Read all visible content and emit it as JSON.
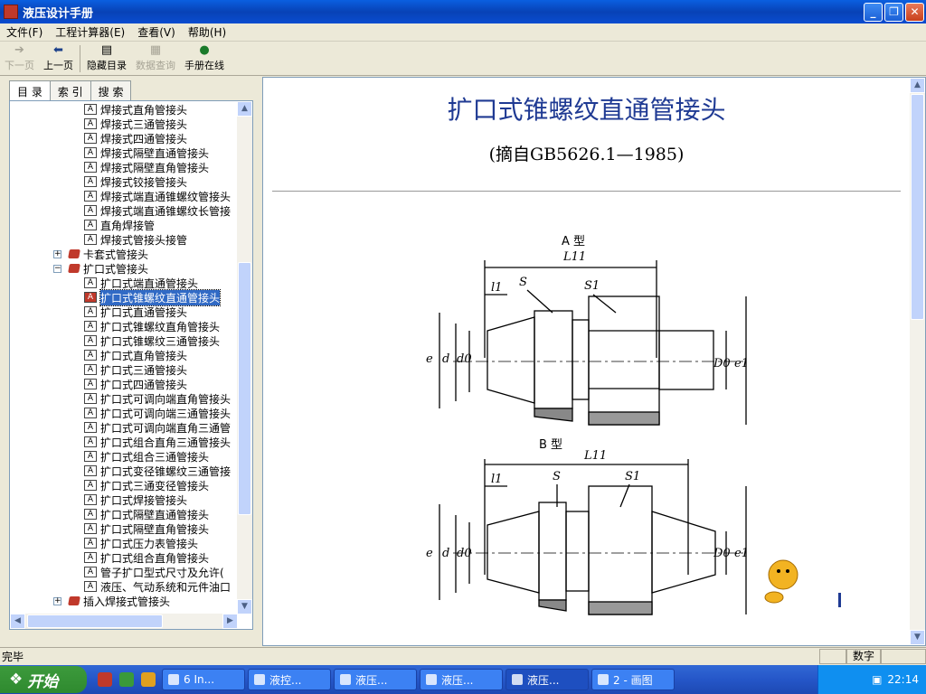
{
  "window": {
    "title": "液压设计手册"
  },
  "menu": [
    "文件(F)",
    "工程计算器(E)",
    "查看(V)",
    "帮助(H)"
  ],
  "toolbar": [
    {
      "label": "下一页",
      "icon": "arrow-right-icon",
      "enabled": false
    },
    {
      "label": "上一页",
      "icon": "arrow-left-icon",
      "enabled": true
    },
    {
      "label": "隐藏目录",
      "icon": "hide-toc-icon",
      "enabled": true
    },
    {
      "label": "数据查询",
      "icon": "data-query-icon",
      "enabled": false
    },
    {
      "label": "手册在线",
      "icon": "globe-icon",
      "enabled": true
    }
  ],
  "tabs": [
    "目 录",
    "索 引",
    "搜 索"
  ],
  "tree": [
    {
      "label": "焊接式直角管接头",
      "level": 3,
      "type": "doc"
    },
    {
      "label": "焊接式三通管接头",
      "level": 3,
      "type": "doc"
    },
    {
      "label": "焊接式四通管接头",
      "level": 3,
      "type": "doc"
    },
    {
      "label": "焊接式隔壁直通管接头",
      "level": 3,
      "type": "doc"
    },
    {
      "label": "焊接式隔壁直角管接头",
      "level": 3,
      "type": "doc"
    },
    {
      "label": "焊接式铰接管接头",
      "level": 3,
      "type": "doc"
    },
    {
      "label": "焊接式端直通锥螺纹管接头",
      "level": 3,
      "type": "doc"
    },
    {
      "label": "焊接式端直通锥螺纹长管接",
      "level": 3,
      "type": "doc"
    },
    {
      "label": "直角焊接管",
      "level": 3,
      "type": "doc"
    },
    {
      "label": "焊接式管接头接管",
      "level": 3,
      "type": "doc"
    },
    {
      "label": "卡套式管接头",
      "level": 2,
      "type": "book",
      "expander": "+"
    },
    {
      "label": "扩口式管接头",
      "level": 2,
      "type": "book",
      "expander": "−"
    },
    {
      "label": "扩口式端直通管接头",
      "level": 3,
      "type": "doc"
    },
    {
      "label": "扩口式锥螺纹直通管接头",
      "level": 3,
      "type": "doc",
      "selected": true
    },
    {
      "label": "扩口式直通管接头",
      "level": 3,
      "type": "doc"
    },
    {
      "label": "扩口式锥螺纹直角管接头",
      "level": 3,
      "type": "doc"
    },
    {
      "label": "扩口式锥螺纹三通管接头",
      "level": 3,
      "type": "doc"
    },
    {
      "label": "扩口式直角管接头",
      "level": 3,
      "type": "doc"
    },
    {
      "label": "扩口式三通管接头",
      "level": 3,
      "type": "doc"
    },
    {
      "label": "扩口式四通管接头",
      "level": 3,
      "type": "doc"
    },
    {
      "label": "扩口式可调向端直角管接头",
      "level": 3,
      "type": "doc"
    },
    {
      "label": "扩口式可调向端三通管接头",
      "level": 3,
      "type": "doc"
    },
    {
      "label": "扩口式可调向端直角三通管",
      "level": 3,
      "type": "doc"
    },
    {
      "label": "扩口式组合直角三通管接头",
      "level": 3,
      "type": "doc"
    },
    {
      "label": "扩口式组合三通管接头",
      "level": 3,
      "type": "doc"
    },
    {
      "label": "扩口式变径锥螺纹三通管接",
      "level": 3,
      "type": "doc"
    },
    {
      "label": "扩口式三通变径管接头",
      "level": 3,
      "type": "doc"
    },
    {
      "label": "扩口式焊接管接头",
      "level": 3,
      "type": "doc"
    },
    {
      "label": "扩口式隔壁直通管接头",
      "level": 3,
      "type": "doc"
    },
    {
      "label": "扩口式隔壁直角管接头",
      "level": 3,
      "type": "doc"
    },
    {
      "label": "扩口式压力表管接头",
      "level": 3,
      "type": "doc"
    },
    {
      "label": "扩口式组合直角管接头",
      "level": 3,
      "type": "doc"
    },
    {
      "label": "管子扩口型式尺寸及允许(",
      "level": 3,
      "type": "doc"
    },
    {
      "label": "液压、气动系统和元件油口",
      "level": 3,
      "type": "doc"
    },
    {
      "label": "插入焊接式管接头",
      "level": 2,
      "type": "book",
      "expander": "+"
    }
  ],
  "doc": {
    "title": "扩口式锥螺纹直通管接头",
    "subtitle": "(摘自GB5626.1—1985)",
    "fig_a": {
      "label": "A 型",
      "L": "L11",
      "l": "l1",
      "S": "S",
      "S1": "S1",
      "e": "e",
      "d": "d",
      "d0": "d0",
      "D0": "D0",
      "e1": "e1"
    },
    "fig_b": {
      "label": "B 型",
      "L": "L11",
      "l": "l1",
      "S": "S",
      "S1": "S1",
      "e": "e",
      "d": "d",
      "d0": "d0",
      "D0": "D0",
      "e1": "e1"
    }
  },
  "status": {
    "text": "完毕",
    "mode": "数字"
  },
  "taskbar": {
    "start": "开始",
    "tasks": [
      {
        "label": "6 In...",
        "active": false
      },
      {
        "label": "液控...",
        "active": false
      },
      {
        "label": "液压...",
        "active": false
      },
      {
        "label": "液压...",
        "active": false
      },
      {
        "label": "液压...",
        "active": true
      },
      {
        "label": "2 - 画图",
        "active": false
      }
    ],
    "clock": "22:14"
  }
}
